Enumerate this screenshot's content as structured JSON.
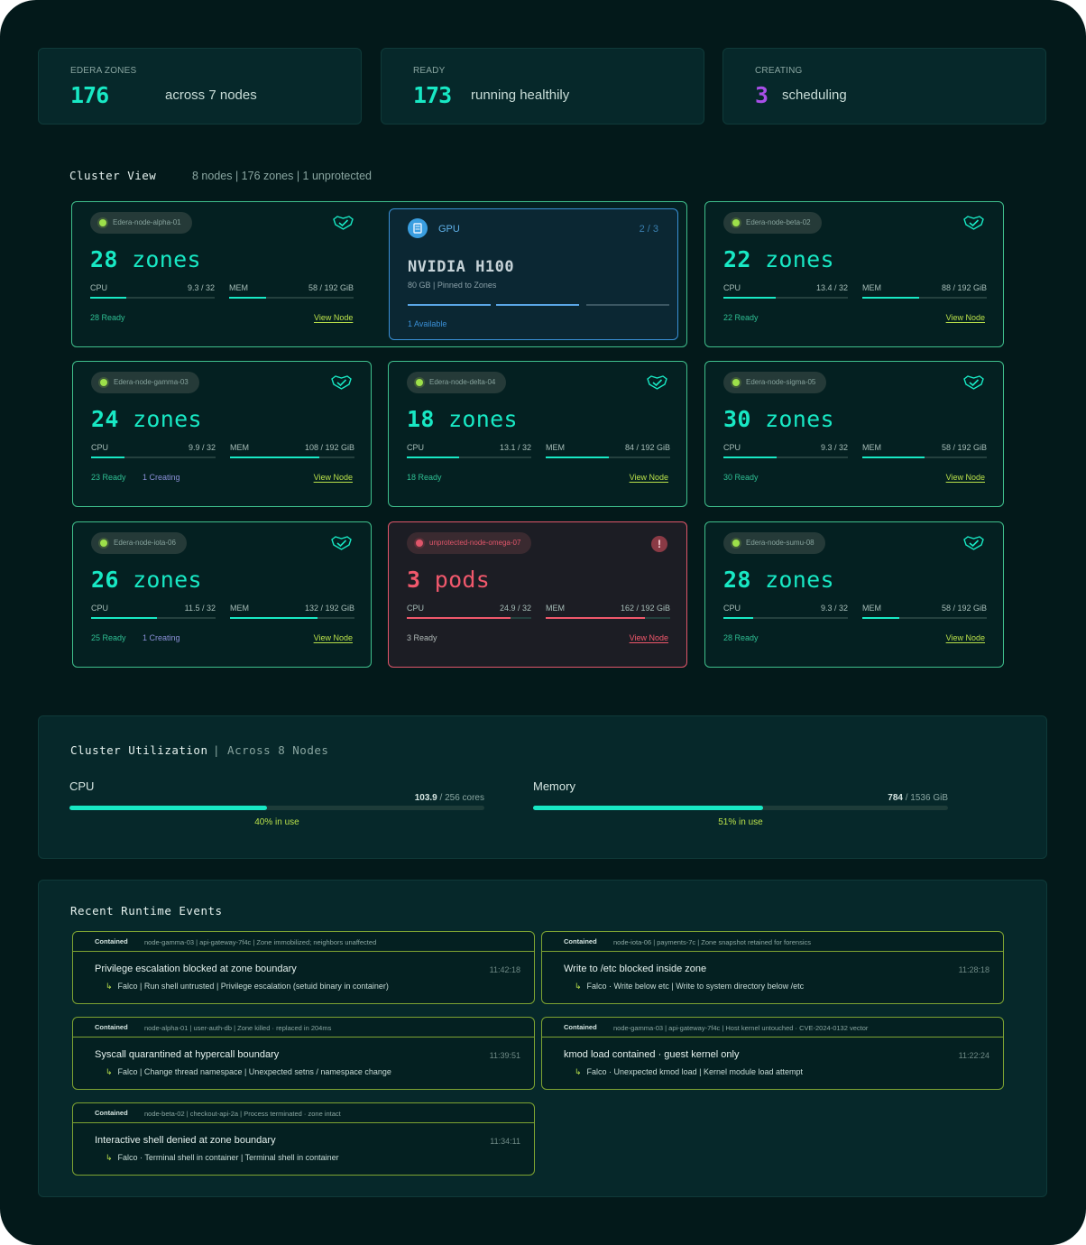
{
  "stats": [
    {
      "label": "EDERA ZONES",
      "value": "176",
      "desc": "across 7 nodes"
    },
    {
      "label": "READY",
      "value": "173",
      "desc": "running healthily"
    },
    {
      "label": "CREATING",
      "value": "3",
      "desc": "scheduling",
      "color": "#a84fe8"
    }
  ],
  "cluster": {
    "title": "Cluster View",
    "meta": "8 nodes | 176 zones | 1 unprotected"
  },
  "gpu": {
    "label": "GPU",
    "count": "2 / 3",
    "name": "NVIDIA H100",
    "sub": "80 GB | Pinned to Zones",
    "available": "1 Available"
  },
  "nodes": [
    {
      "name": "Edera-node-alpha-01",
      "count": "28",
      "unit": "zones",
      "cpu": "9.3 / 32",
      "cpu_frac": 0.29,
      "mem": "58 / 192 GiB",
      "mem_frac": 0.3,
      "ready": "28 Ready",
      "creating": "",
      "link": "View Node"
    },
    {
      "name": "Edera-node-beta-02",
      "count": "22",
      "unit": "zones",
      "cpu": "13.4 / 32",
      "cpu_frac": 0.42,
      "mem": "88 / 192 GiB",
      "mem_frac": 0.46,
      "ready": "22 Ready",
      "creating": "",
      "link": "View Node"
    },
    {
      "name": "Edera-node-gamma-03",
      "count": "24",
      "unit": "zones",
      "cpu": "9.9 / 32",
      "cpu_frac": 0.27,
      "mem": "108 / 192 GiB",
      "mem_frac": 0.72,
      "ready": "23 Ready",
      "creating": "1 Creating",
      "link": "View Node"
    },
    {
      "name": "Edera-node-delta-04",
      "count": "18",
      "unit": "zones",
      "cpu": "13.1 / 32",
      "cpu_frac": 0.42,
      "mem": "84 / 192 GiB",
      "mem_frac": 0.51,
      "ready": "18 Ready",
      "creating": "",
      "link": "View Node"
    },
    {
      "name": "Edera-node-sigma-05",
      "count": "30",
      "unit": "zones",
      "cpu": "9.3 / 32",
      "cpu_frac": 0.43,
      "mem": "58 / 192 GiB",
      "mem_frac": 0.5,
      "ready": "30 Ready",
      "creating": "",
      "link": "View Node"
    },
    {
      "name": "Edera-node-iota-06",
      "count": "26",
      "unit": "zones",
      "cpu": "11.5 / 32",
      "cpu_frac": 0.53,
      "mem": "132 / 192 GiB",
      "mem_frac": 0.7,
      "ready": "25 Ready",
      "creating": "1 Creating",
      "link": "View Node"
    },
    {
      "name": "unprotected-node-omega-07",
      "count": "3",
      "unit": "pods",
      "cpu": "24.9 / 32",
      "cpu_frac": 0.83,
      "mem": "162 / 192 GiB",
      "mem_frac": 0.8,
      "ready": "3 Ready",
      "creating": "",
      "link": "View Node",
      "alert": true
    },
    {
      "name": "Edera-node-sumu-08",
      "count": "28",
      "unit": "zones",
      "cpu": "9.3 / 32",
      "cpu_frac": 0.24,
      "mem": "58 / 192 GiB",
      "mem_frac": 0.3,
      "ready": "28 Ready",
      "creating": "",
      "link": "View Node"
    }
  ],
  "utilization": {
    "title": "Cluster Utilization",
    "sub": "| Across 8 Nodes",
    "cpu": {
      "name": "CPU",
      "used": "103.9",
      "total": " / 256 cores",
      "pct": "40% in use",
      "frac": 0.475
    },
    "memory": {
      "name": "Memory",
      "used": "784",
      "total": " / 1536 GiB",
      "pct": "51% in use",
      "frac": 0.555
    }
  },
  "events": {
    "title": "Recent Runtime Events",
    "items": [
      {
        "tag": "Contained",
        "meta": "node-gamma-03 | api-gateway-7f4c | Zone immobilized; neighbors unaffected",
        "name": "Privilege escalation blocked at zone boundary",
        "time": "11:42:18",
        "detail": "Falco  |  Run shell untrusted  |  Privilege escalation (setuid binary in container)"
      },
      {
        "tag": "Contained",
        "meta": "node-iota-06  |  payments-7c  |  Zone snapshot retained for forensics",
        "name": "Write to /etc blocked inside zone",
        "time": "11:28:18",
        "detail": "Falco · Write below etc  |  Write to system directory below /etc"
      },
      {
        "tag": "Contained",
        "meta": "node-alpha-01  |  user-auth-db  |  Zone killed · replaced in 204ms",
        "name": "Syscall quarantined at hypercall boundary",
        "time": "11:39:51",
        "detail": "Falco  |  Change thread namespace  |  Unexpected setns / namespace change"
      },
      {
        "tag": "Contained",
        "meta": "node-gamma-03  |  api-gateway-7f4c  |  Host kernel untouched · CVE-2024-0132 vector",
        "name": "kmod load contained · guest kernel only",
        "time": "11:22:24",
        "detail": "Falco · Unexpected kmod load  |  Kernel module load attempt"
      },
      {
        "tag": "Contained",
        "meta": "node-beta-02  |  checkout-api-2a  |  Process terminated · zone intact",
        "name": "Interactive shell denied at zone boundary",
        "time": "11:34:11",
        "detail": "Falco · Terminal shell in container  |  Terminal shell in container"
      }
    ]
  }
}
